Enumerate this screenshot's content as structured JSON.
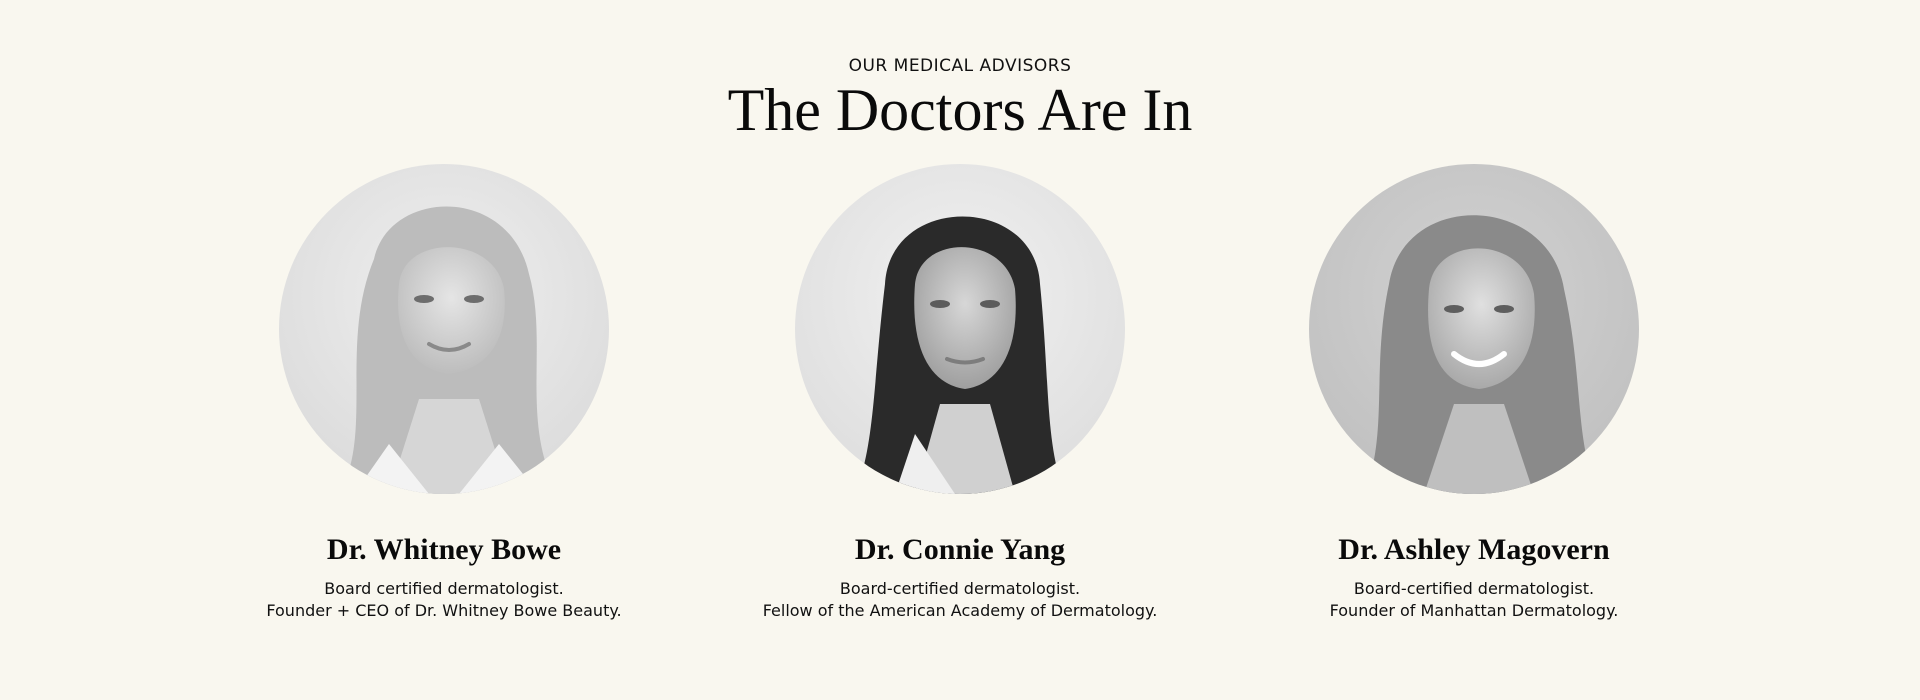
{
  "header": {
    "eyebrow": "OUR MEDICAL ADVISORS",
    "title": "The Doctors Are In"
  },
  "doctors": [
    {
      "name": "Dr. Whitney Bowe",
      "line1": "Board certified dermatologist.",
      "line2": "Founder + CEO of Dr. Whitney Bowe Beauty."
    },
    {
      "name": "Dr. Connie Yang",
      "line1": "Board-certified dermatologist.",
      "line2": "Fellow of the American Academy of Dermatology."
    },
    {
      "name": "Dr. Ashley Magovern",
      "line1": "Board-certified dermatologist.",
      "line2": "Founder of Manhattan Dermatology."
    }
  ],
  "colors": {
    "background": "#f9f7ef",
    "text": "#111111"
  }
}
